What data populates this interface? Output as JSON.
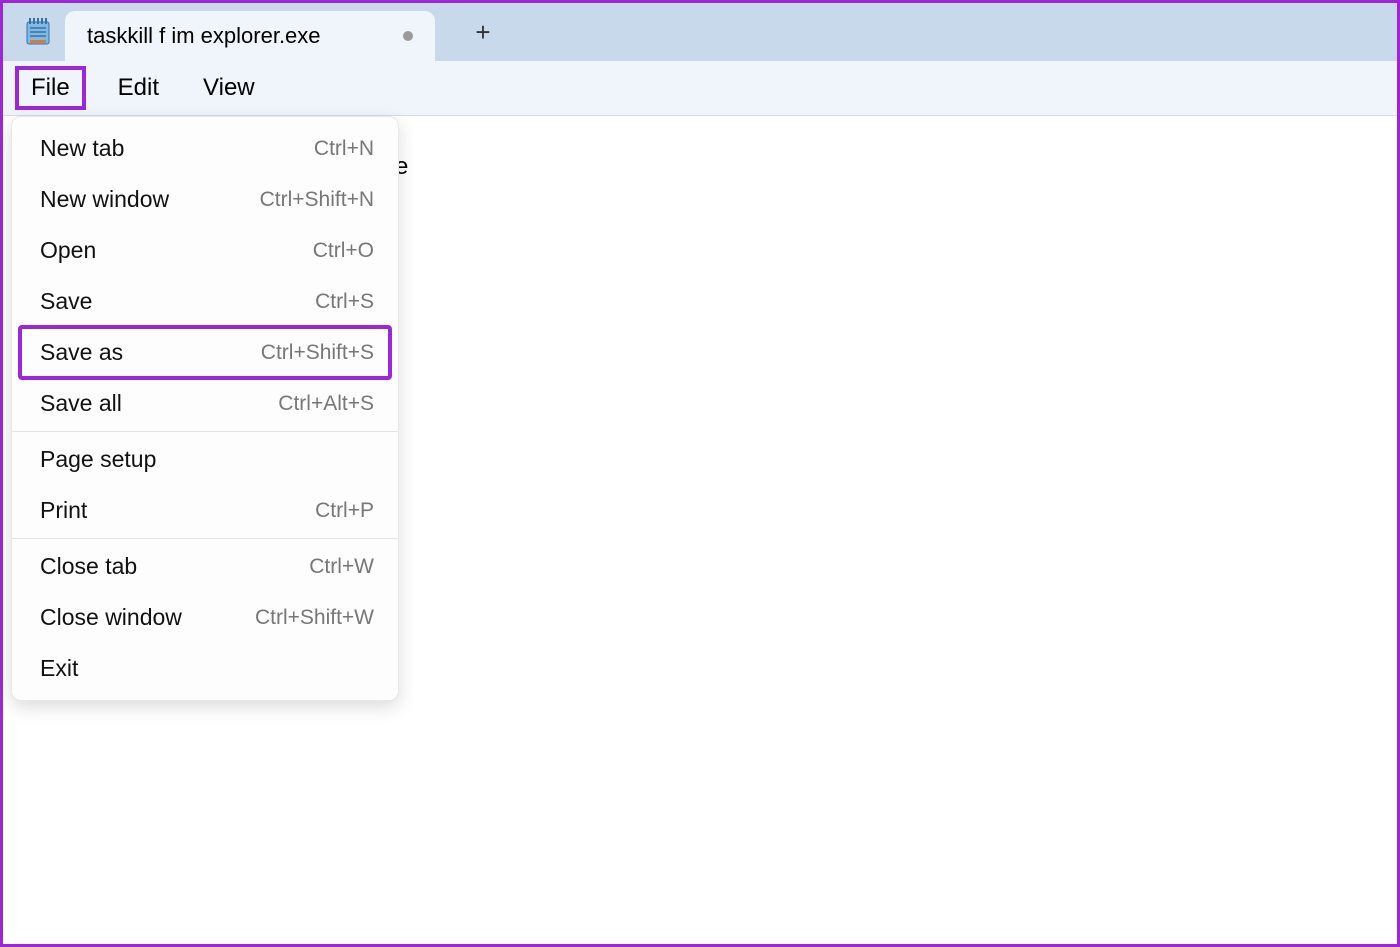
{
  "tab": {
    "title": "taskkill f im explorer.exe"
  },
  "newtab_glyph": "+",
  "menubar": {
    "file": "File",
    "edit": "Edit",
    "view": "View"
  },
  "editor": {
    "visible_fragment": "e"
  },
  "dropdown": {
    "items": [
      {
        "label": "New tab",
        "shortcut": "Ctrl+N"
      },
      {
        "label": "New window",
        "shortcut": "Ctrl+Shift+N"
      },
      {
        "label": "Open",
        "shortcut": "Ctrl+O"
      },
      {
        "label": "Save",
        "shortcut": "Ctrl+S"
      },
      {
        "label": "Save as",
        "shortcut": "Ctrl+Shift+S"
      },
      {
        "label": "Save all",
        "shortcut": "Ctrl+Alt+S"
      },
      {
        "label": "Page setup",
        "shortcut": ""
      },
      {
        "label": "Print",
        "shortcut": "Ctrl+P"
      },
      {
        "label": "Close tab",
        "shortcut": "Ctrl+W"
      },
      {
        "label": "Close window",
        "shortcut": "Ctrl+Shift+W"
      },
      {
        "label": "Exit",
        "shortcut": ""
      }
    ]
  },
  "colors": {
    "highlight": "#9c27d9"
  }
}
